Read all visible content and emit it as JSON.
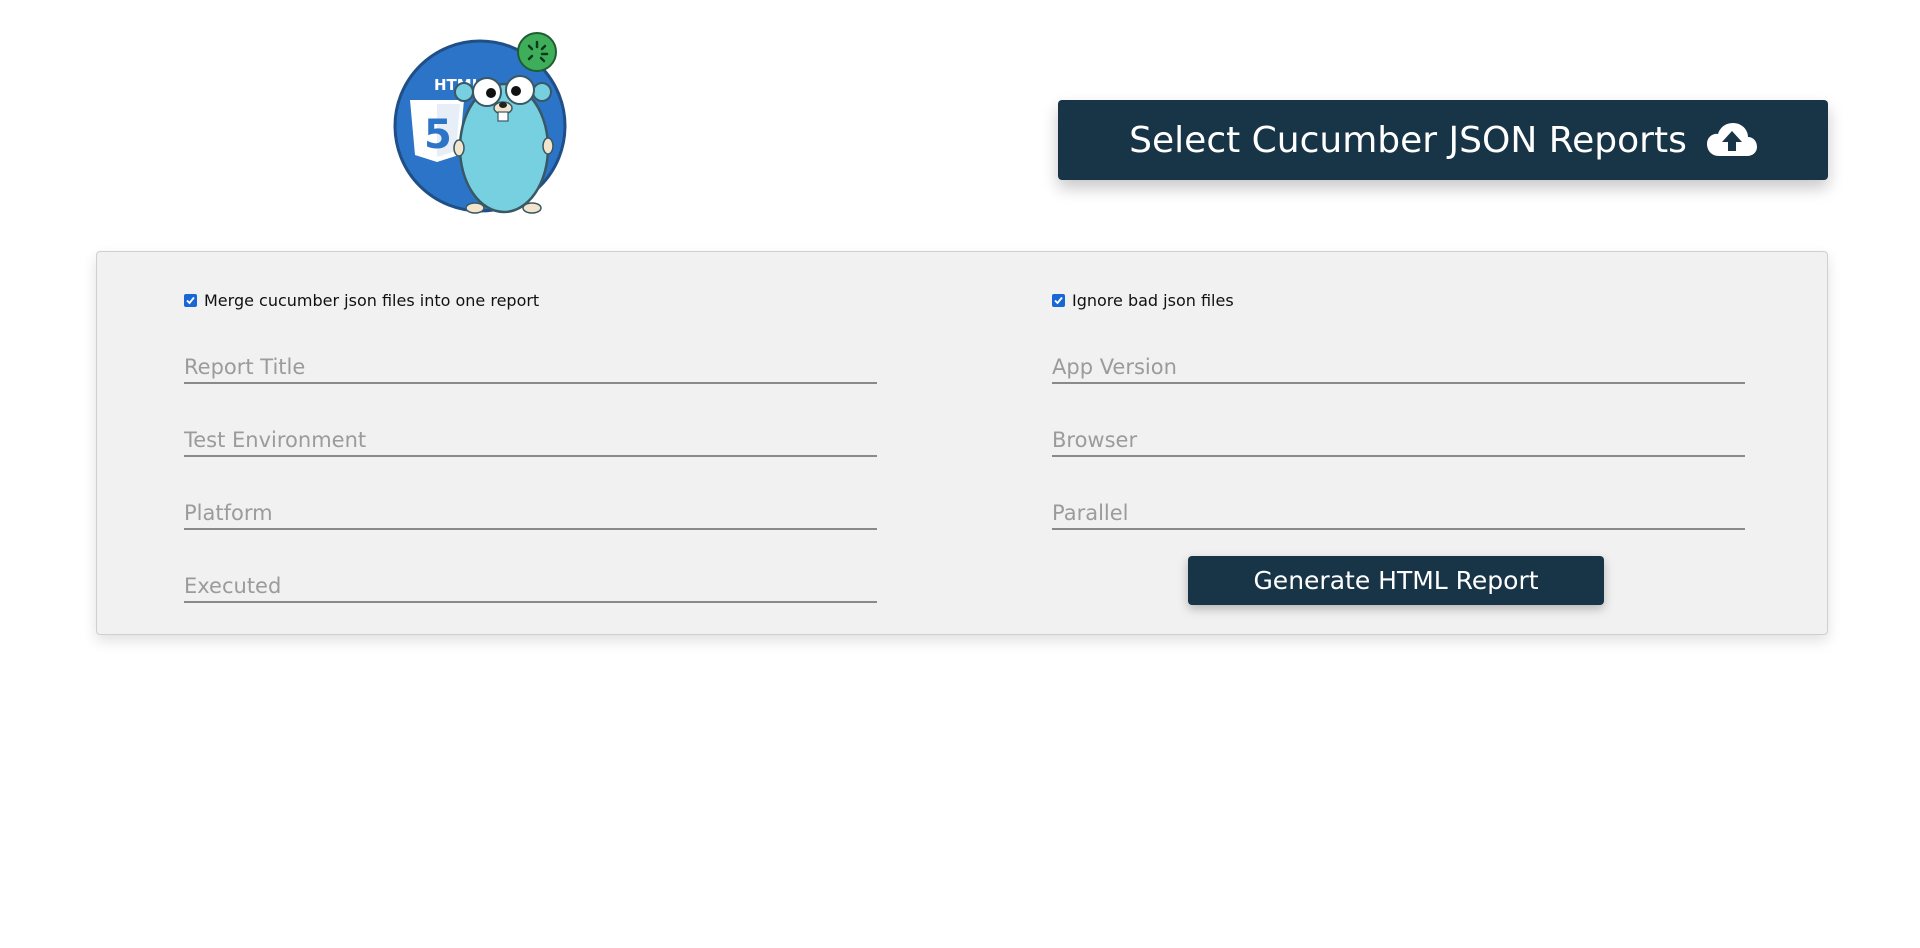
{
  "header": {
    "logo_icon": "html5-gopher-cucumber-logo-icon",
    "select_button": {
      "label": "Select Cucumber JSON Reports",
      "icon": "cloud-upload-icon"
    }
  },
  "options": {
    "merge": {
      "label": "Merge cucumber json files into one report",
      "checked": true
    },
    "ignore_bad": {
      "label": "Ignore bad json files",
      "checked": true
    }
  },
  "fields": {
    "report_title": {
      "value": "",
      "placeholder": "Report Title"
    },
    "app_version": {
      "value": "",
      "placeholder": "App Version"
    },
    "test_environment": {
      "value": "",
      "placeholder": "Test Environment"
    },
    "browser": {
      "value": "",
      "placeholder": "Browser"
    },
    "platform": {
      "value": "",
      "placeholder": "Platform"
    },
    "parallel": {
      "value": "",
      "placeholder": "Parallel"
    },
    "executed": {
      "value": "",
      "placeholder": "Executed"
    }
  },
  "generate_button": {
    "label": "Generate HTML Report"
  },
  "colors": {
    "primary": "#183548",
    "panel_bg": "#f1f1f1",
    "checkbox": "#1a66d6",
    "logo_circle": "#2b74c7",
    "gopher": "#76d0e0",
    "cucumber": "#3fae5a"
  }
}
